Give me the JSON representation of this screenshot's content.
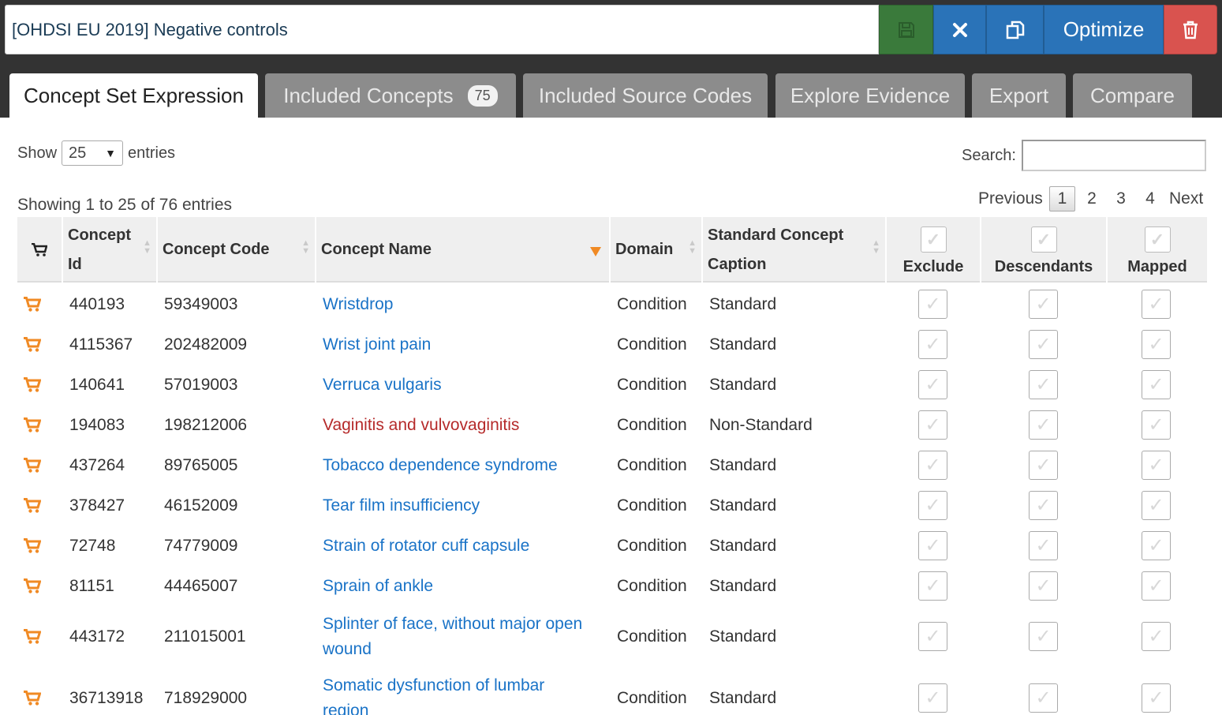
{
  "concept_set_name": "[OHDSI EU 2019] Negative controls",
  "buttons": {
    "optimize": "Optimize"
  },
  "icons": {
    "save": "save-icon",
    "close": "close-icon",
    "copy": "copy-icon",
    "delete": "trash-icon",
    "cart": "cart-icon",
    "check": "check-icon"
  },
  "colors": {
    "header_bg": "#333333",
    "primary": "#2a73b8",
    "success": "#3a7a3b",
    "danger": "#d9534f",
    "link": "#1a73c7",
    "non_standard_link": "#b52a2a",
    "cart": "#f08a24"
  },
  "tabs": [
    {
      "label": "Concept Set Expression",
      "active": true
    },
    {
      "label": "Included Concepts",
      "badge": "75"
    },
    {
      "label": "Included Source Codes"
    },
    {
      "label": "Explore Evidence"
    },
    {
      "label": "Export"
    },
    {
      "label": "Compare"
    }
  ],
  "length_control": {
    "show": "Show",
    "value": "25",
    "entries": "entries"
  },
  "search": {
    "label": "Search:",
    "value": ""
  },
  "info": "Showing 1 to 25 of 76 entries",
  "pagination": {
    "previous": "Previous",
    "pages": [
      "1",
      "2",
      "3",
      "4"
    ],
    "current": "1",
    "next": "Next"
  },
  "columns": {
    "concept_id": "Concept Id",
    "concept_code": "Concept Code",
    "concept_name": "Concept Name",
    "domain": "Domain",
    "standard": "Standard Concept Caption",
    "exclude": "Exclude",
    "descendants": "Descendants",
    "mapped": "Mapped"
  },
  "rows": [
    {
      "id": "440193",
      "code": "59349003",
      "name": "Wristdrop",
      "domain": "Condition",
      "standard": "Standard",
      "is_standard": true
    },
    {
      "id": "4115367",
      "code": "202482009",
      "name": "Wrist joint pain",
      "domain": "Condition",
      "standard": "Standard",
      "is_standard": true
    },
    {
      "id": "140641",
      "code": "57019003",
      "name": "Verruca vulgaris",
      "domain": "Condition",
      "standard": "Standard",
      "is_standard": true
    },
    {
      "id": "194083",
      "code": "198212006",
      "name": "Vaginitis and vulvovaginitis",
      "domain": "Condition",
      "standard": "Non-Standard",
      "is_standard": false
    },
    {
      "id": "437264",
      "code": "89765005",
      "name": "Tobacco dependence syndrome",
      "domain": "Condition",
      "standard": "Standard",
      "is_standard": true
    },
    {
      "id": "378427",
      "code": "46152009",
      "name": "Tear film insufficiency",
      "domain": "Condition",
      "standard": "Standard",
      "is_standard": true
    },
    {
      "id": "72748",
      "code": "74779009",
      "name": "Strain of rotator cuff capsule",
      "domain": "Condition",
      "standard": "Standard",
      "is_standard": true
    },
    {
      "id": "81151",
      "code": "44465007",
      "name": "Sprain of ankle",
      "domain": "Condition",
      "standard": "Standard",
      "is_standard": true
    },
    {
      "id": "443172",
      "code": "211015001",
      "name": "Splinter of face, without major open wound",
      "domain": "Condition",
      "standard": "Standard",
      "is_standard": true
    },
    {
      "id": "36713918",
      "code": "718929000",
      "name": "Somatic dysfunction of lumbar region",
      "domain": "Condition",
      "standard": "Standard",
      "is_standard": true
    }
  ]
}
